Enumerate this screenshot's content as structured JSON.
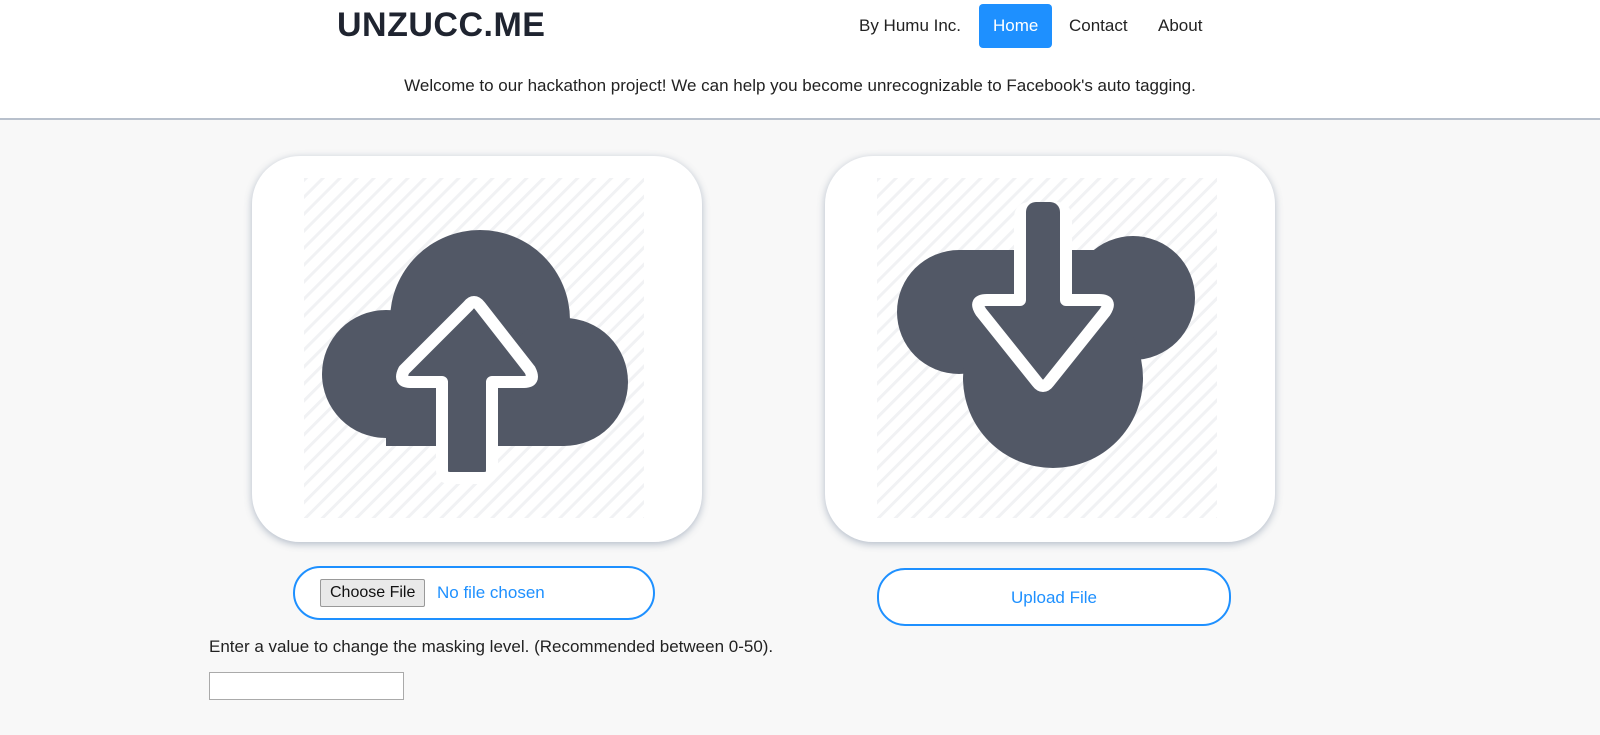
{
  "header": {
    "brand": "UNZUCC.ME",
    "nav": [
      {
        "label": "By Humu Inc."
      },
      {
        "label": "Home",
        "active": true
      },
      {
        "label": "Contact"
      },
      {
        "label": "About"
      }
    ],
    "welcome": "Welcome to our hackathon project! We can help you become unrecognizable to Facebook's auto tagging."
  },
  "upload_card": {
    "icon": "cloud-upload-icon"
  },
  "download_card": {
    "icon": "cloud-download-icon"
  },
  "file_input": {
    "button_label": "Choose File",
    "status": "No file chosen"
  },
  "upload_button": {
    "label": "Upload File"
  },
  "masking": {
    "hint": "Enter a value to change the masking level. (Recommended between 0-50).",
    "value": ""
  },
  "colors": {
    "accent": "#1e90ff",
    "icon": "#525866"
  }
}
